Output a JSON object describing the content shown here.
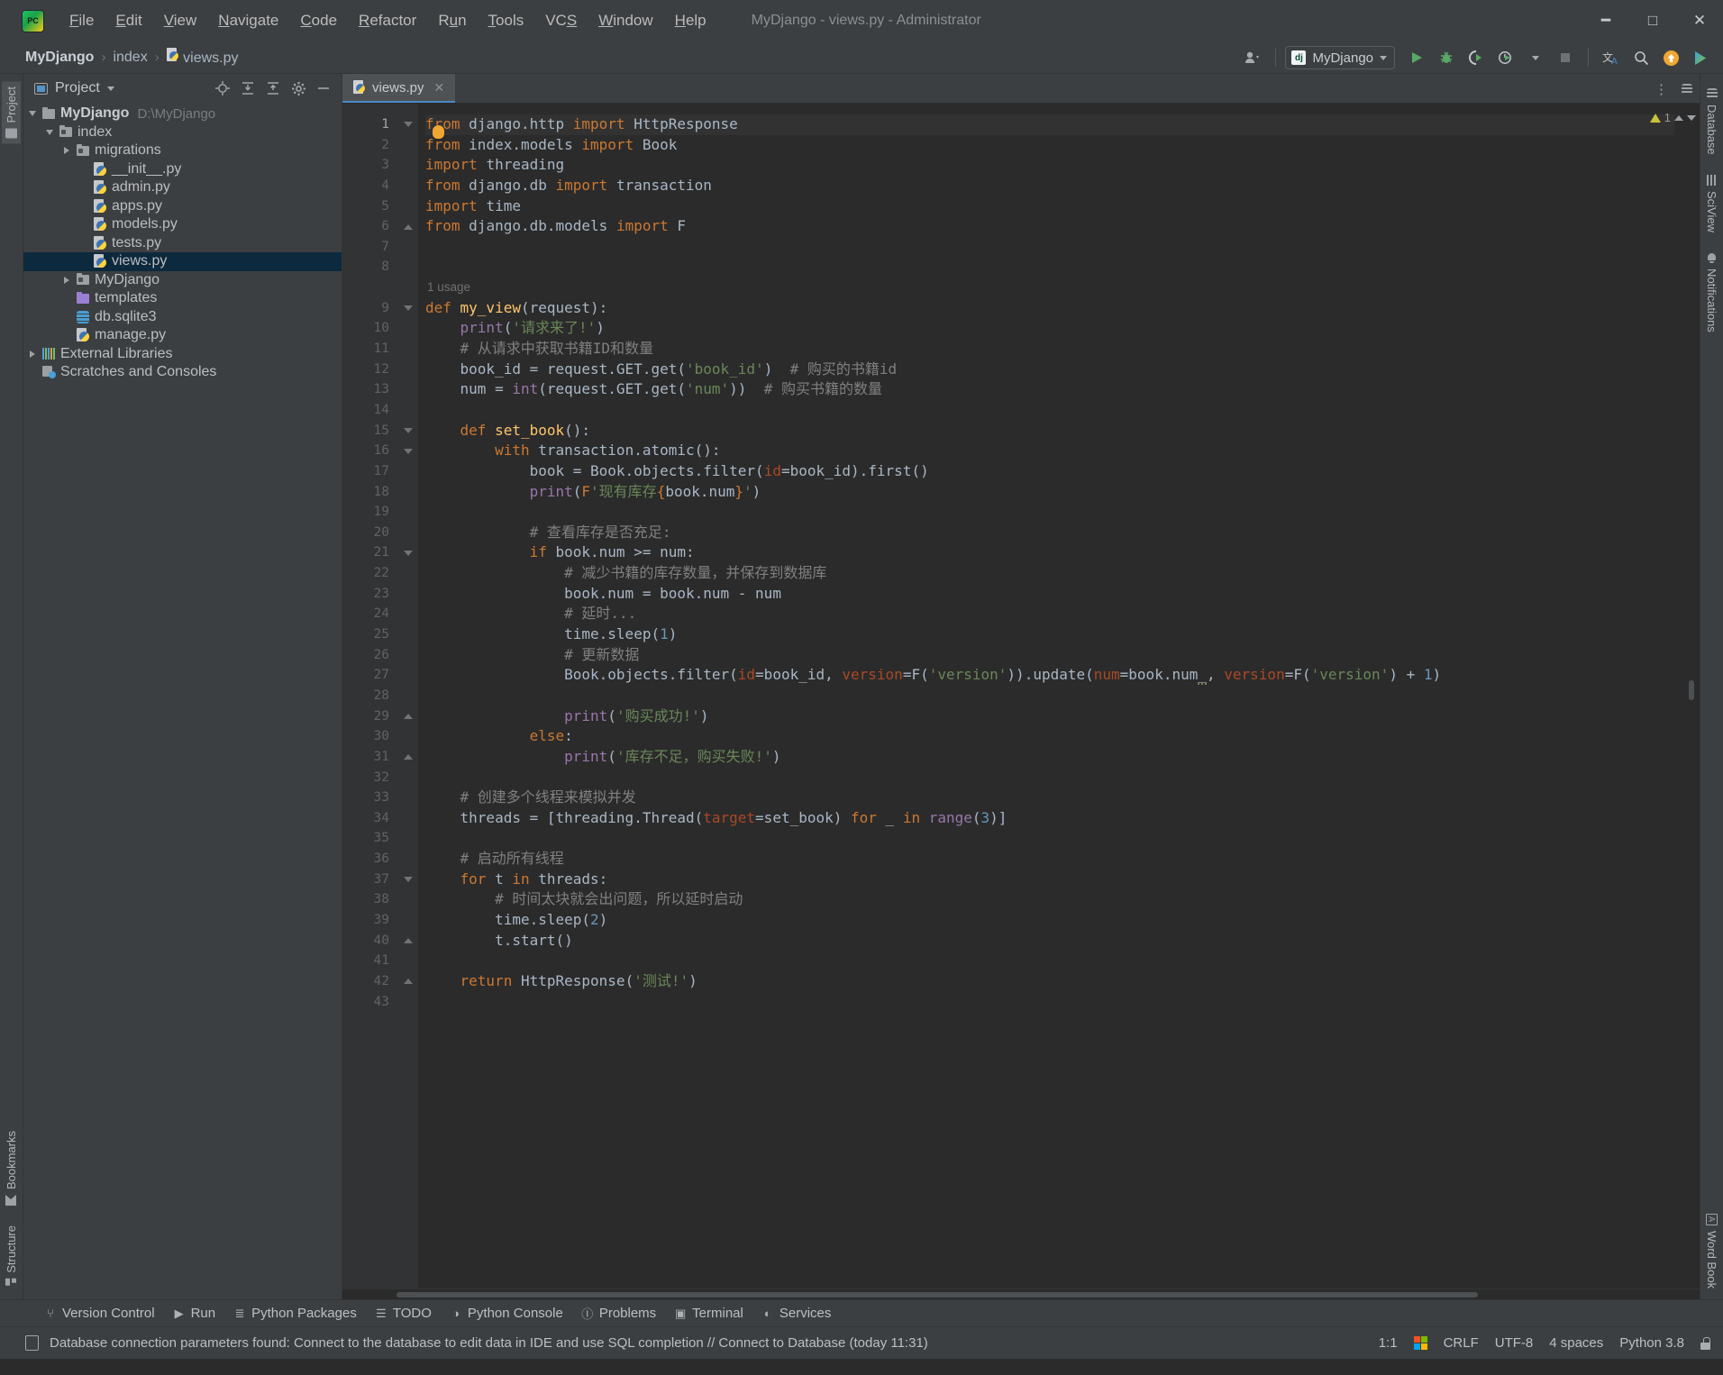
{
  "window": {
    "title": "MyDjango - views.py - Administrator",
    "minimize": "─",
    "maximize": "☐",
    "close": "✕"
  },
  "menu": [
    {
      "label": "File"
    },
    {
      "label": "Edit"
    },
    {
      "label": "View"
    },
    {
      "label": "Navigate"
    },
    {
      "label": "Code"
    },
    {
      "label": "Refactor"
    },
    {
      "label": "Run"
    },
    {
      "label": "Tools"
    },
    {
      "label": "VCS"
    },
    {
      "label": "Window"
    },
    {
      "label": "Help"
    }
  ],
  "breadcrumb": {
    "project": "MyDjango",
    "sep": "›",
    "folder": "index",
    "file": "views.py"
  },
  "toolbar": {
    "account_icon": "account-icon",
    "run_config_label": "MyDjango",
    "django_badge": "dj",
    "run_icon": "▶",
    "debug_icon": "debug-bug-icon",
    "coverage_icon": "coverage-icon",
    "profile_icon": "profile-clock-icon",
    "stop_icon": "■",
    "translate_icon": "文",
    "search_icon": "⌕",
    "update_icon": "↑",
    "ide_icon": "▶"
  },
  "left_rail": {
    "top": [
      {
        "label": "Project",
        "icon": "project-folder-icon",
        "active": true
      }
    ],
    "bottom": [
      {
        "label": "Bookmarks",
        "icon": "bookmark-icon"
      },
      {
        "label": "Structure",
        "icon": "structure-icon"
      }
    ]
  },
  "right_rail": {
    "top": [
      {
        "label": "Database",
        "icon": "database-icon"
      },
      {
        "label": "SciView",
        "icon": "sciview-grid-icon"
      },
      {
        "label": "Notifications",
        "icon": "bell-icon"
      }
    ],
    "bottom": [
      {
        "label": "Word Book",
        "icon": "word-book-icon"
      }
    ]
  },
  "project_panel": {
    "title": "Project",
    "dropdown_icon": "chevron-down-icon",
    "actions": [
      {
        "name": "locate-icon",
        "glyph": "⊕"
      },
      {
        "name": "expand-all-icon",
        "glyph": "⤓"
      },
      {
        "name": "collapse-all-icon",
        "glyph": "⤒"
      },
      {
        "name": "settings-gear-icon",
        "glyph": "⚙"
      },
      {
        "name": "hide-panel-icon",
        "glyph": "—"
      }
    ],
    "tree": [
      {
        "label": "MyDjango",
        "path": "D:\\MyDjango",
        "indent": 0,
        "twisty": "open",
        "icon": "folder-root-icon",
        "bold": true
      },
      {
        "label": "index",
        "path": "",
        "indent": 1,
        "twisty": "open",
        "icon": "folder-module-icon",
        "bold": false
      },
      {
        "label": "migrations",
        "path": "",
        "indent": 2,
        "twisty": "closed",
        "icon": "folder-module-icon",
        "bold": false
      },
      {
        "label": "__init__.py",
        "path": "",
        "indent": 3,
        "twisty": "none",
        "icon": "python-file-icon",
        "bold": false
      },
      {
        "label": "admin.py",
        "path": "",
        "indent": 3,
        "twisty": "none",
        "icon": "python-file-icon",
        "bold": false
      },
      {
        "label": "apps.py",
        "path": "",
        "indent": 3,
        "twisty": "none",
        "icon": "python-file-icon",
        "bold": false
      },
      {
        "label": "models.py",
        "path": "",
        "indent": 3,
        "twisty": "none",
        "icon": "python-file-icon",
        "bold": false
      },
      {
        "label": "tests.py",
        "path": "",
        "indent": 3,
        "twisty": "none",
        "icon": "python-file-icon",
        "bold": false
      },
      {
        "label": "views.py",
        "path": "",
        "indent": 3,
        "twisty": "none",
        "icon": "python-file-icon",
        "bold": false,
        "selected": true
      },
      {
        "label": "MyDjango",
        "path": "",
        "indent": 2,
        "twisty": "closed",
        "icon": "folder-module-icon",
        "bold": false
      },
      {
        "label": "templates",
        "path": "",
        "indent": 2,
        "twisty": "none",
        "icon": "folder-templates-icon",
        "bold": false
      },
      {
        "label": "db.sqlite3",
        "path": "",
        "indent": 2,
        "twisty": "none",
        "icon": "database-file-icon",
        "bold": false
      },
      {
        "label": "manage.py",
        "path": "",
        "indent": 2,
        "twisty": "none",
        "icon": "python-file-icon",
        "bold": false
      },
      {
        "label": "External Libraries",
        "path": "",
        "indent": 0,
        "twisty": "closed",
        "icon": "libraries-icon",
        "bold": false
      },
      {
        "label": "Scratches and Consoles",
        "path": "",
        "indent": 0,
        "twisty": "none",
        "icon": "scratches-icon",
        "bold": false
      }
    ]
  },
  "editor": {
    "tabs": [
      {
        "label": "views.py",
        "icon": "python-file-icon",
        "active": true,
        "close": "✕"
      }
    ],
    "kebab": "⋮",
    "warning_count": "1",
    "warning_icon": "warning-triangle-icon",
    "usage_hint": "1 usage",
    "usage_hint_line": 8,
    "total_lines": 43,
    "lines": [
      {
        "n": 1,
        "fold": "tri-down",
        "segs": [
          [
            "kw",
            "from "
          ],
          [
            "plain",
            "django.http "
          ],
          [
            "kw",
            "import "
          ],
          [
            "plain",
            "HttpResponse"
          ]
        ]
      },
      {
        "n": 2,
        "fold": "",
        "segs": [
          [
            "kw",
            "from "
          ],
          [
            "plain",
            "index.models "
          ],
          [
            "kw",
            "import "
          ],
          [
            "plain",
            "Book"
          ]
        ]
      },
      {
        "n": 3,
        "fold": "",
        "segs": [
          [
            "kw",
            "import "
          ],
          [
            "plain",
            "threading"
          ]
        ]
      },
      {
        "n": 4,
        "fold": "",
        "segs": [
          [
            "kw",
            "from "
          ],
          [
            "plain",
            "django.db "
          ],
          [
            "kw",
            "import "
          ],
          [
            "plain",
            "transaction"
          ]
        ]
      },
      {
        "n": 5,
        "fold": "",
        "segs": [
          [
            "kw",
            "import "
          ],
          [
            "plain",
            "time"
          ]
        ]
      },
      {
        "n": 6,
        "fold": "tri-up",
        "segs": [
          [
            "kw",
            "from "
          ],
          [
            "plain",
            "django.db.models "
          ],
          [
            "kw",
            "import "
          ],
          [
            "plain",
            "F"
          ]
        ]
      },
      {
        "n": 7,
        "fold": "",
        "segs": []
      },
      {
        "n": 8,
        "fold": "",
        "segs": []
      },
      {
        "n": 9,
        "fold": "tri-down",
        "segs": [
          [
            "kw",
            "def "
          ],
          [
            "deffn",
            "my_view"
          ],
          [
            "plain",
            "(request):"
          ]
        ]
      },
      {
        "n": 10,
        "fold": "",
        "segs": [
          [
            "plain",
            "    "
          ],
          [
            "purple",
            "print"
          ],
          [
            "plain",
            "("
          ],
          [
            "str",
            "'请求来了!'"
          ],
          [
            "plain",
            ")"
          ]
        ]
      },
      {
        "n": 11,
        "fold": "",
        "segs": [
          [
            "cmt",
            "    # 从请求中获取书籍ID和数量"
          ]
        ]
      },
      {
        "n": 12,
        "fold": "",
        "segs": [
          [
            "plain",
            "    book_id = request.GET.get("
          ],
          [
            "str",
            "'book_id'"
          ],
          [
            "plain",
            ")  "
          ],
          [
            "cmt",
            "# 购买的书籍id"
          ]
        ]
      },
      {
        "n": 13,
        "fold": "",
        "segs": [
          [
            "plain",
            "    num = "
          ],
          [
            "purple",
            "int"
          ],
          [
            "plain",
            "(request.GET.get("
          ],
          [
            "str",
            "'num'"
          ],
          [
            "plain",
            "))  "
          ],
          [
            "cmt",
            "# 购买书籍的数量"
          ]
        ]
      },
      {
        "n": 14,
        "fold": "",
        "segs": []
      },
      {
        "n": 15,
        "fold": "box",
        "segs": [
          [
            "plain",
            "    "
          ],
          [
            "kw",
            "def "
          ],
          [
            "deffn",
            "set_book"
          ],
          [
            "plain",
            "():"
          ]
        ]
      },
      {
        "n": 16,
        "fold": "box",
        "segs": [
          [
            "plain",
            "        "
          ],
          [
            "kw",
            "with "
          ],
          [
            "plain",
            "transaction.atomic():"
          ]
        ]
      },
      {
        "n": 17,
        "fold": "",
        "segs": [
          [
            "plain",
            "            book = Book.objects.filter("
          ],
          [
            "kwarg",
            "id"
          ],
          [
            "plain",
            "=book_id).first()"
          ]
        ]
      },
      {
        "n": 18,
        "fold": "",
        "segs": [
          [
            "plain",
            "            "
          ],
          [
            "purple",
            "print"
          ],
          [
            "plain",
            "("
          ],
          [
            "fn2",
            "F"
          ],
          [
            "str",
            "'现有库存"
          ],
          [
            "fstr-br",
            "{"
          ],
          [
            "plain",
            "book.num"
          ],
          [
            "fstr-br",
            "}"
          ],
          [
            "str",
            "'"
          ],
          [
            "plain",
            ")"
          ]
        ]
      },
      {
        "n": 19,
        "fold": "",
        "segs": []
      },
      {
        "n": 20,
        "fold": "",
        "segs": [
          [
            "cmt",
            "            # 查看库存是否充足:"
          ]
        ]
      },
      {
        "n": 21,
        "fold": "box",
        "segs": [
          [
            "plain",
            "            "
          ],
          [
            "kw",
            "if "
          ],
          [
            "plain",
            "book.num >= num:"
          ]
        ]
      },
      {
        "n": 22,
        "fold": "",
        "segs": [
          [
            "cmt",
            "                # 减少书籍的库存数量，并保存到数据库"
          ]
        ]
      },
      {
        "n": 23,
        "fold": "",
        "segs": [
          [
            "plain",
            "                book.num = book.num - num"
          ]
        ]
      },
      {
        "n": 24,
        "fold": "",
        "segs": [
          [
            "cmt",
            "                # 延时..."
          ]
        ]
      },
      {
        "n": 25,
        "fold": "",
        "segs": [
          [
            "plain",
            "                time.sleep("
          ],
          [
            "num",
            "1"
          ],
          [
            "plain",
            ")"
          ]
        ]
      },
      {
        "n": 26,
        "fold": "",
        "segs": [
          [
            "cmt",
            "                # 更新数据"
          ]
        ]
      },
      {
        "n": 27,
        "fold": "",
        "segs": [
          [
            "plain",
            "                Book.objects.filter("
          ],
          [
            "kwarg",
            "id"
          ],
          [
            "plain",
            "=book_id, "
          ],
          [
            "kwarg",
            "version"
          ],
          [
            "plain",
            "=F("
          ],
          [
            "str",
            "'version'"
          ],
          [
            "plain",
            ")).update("
          ],
          [
            "kwarg",
            "num"
          ],
          [
            "plain",
            "=book.num"
          ],
          [
            "squig",
            "_"
          ],
          [
            "plain",
            ", "
          ],
          [
            "kwarg",
            "version"
          ],
          [
            "plain",
            "=F("
          ],
          [
            "str",
            "'version'"
          ],
          [
            "plain",
            ") + "
          ],
          [
            "num",
            "1"
          ],
          [
            "plain",
            ")"
          ]
        ]
      },
      {
        "n": 28,
        "fold": "",
        "segs": []
      },
      {
        "n": 29,
        "fold": "box-up",
        "segs": [
          [
            "plain",
            "                "
          ],
          [
            "purple",
            "print"
          ],
          [
            "plain",
            "("
          ],
          [
            "str",
            "'购买成功!'"
          ],
          [
            "plain",
            ")"
          ]
        ]
      },
      {
        "n": 30,
        "fold": "",
        "segs": [
          [
            "plain",
            "            "
          ],
          [
            "kw",
            "else"
          ],
          [
            "plain",
            ":"
          ]
        ]
      },
      {
        "n": 31,
        "fold": "box-up",
        "segs": [
          [
            "plain",
            "                "
          ],
          [
            "purple",
            "print"
          ],
          [
            "plain",
            "("
          ],
          [
            "str",
            "'库存不足，购买失败!'"
          ],
          [
            "plain",
            ")"
          ]
        ]
      },
      {
        "n": 32,
        "fold": "",
        "segs": []
      },
      {
        "n": 33,
        "fold": "",
        "segs": [
          [
            "cmt",
            "    # 创建多个线程来模拟并发"
          ]
        ]
      },
      {
        "n": 34,
        "fold": "",
        "segs": [
          [
            "plain",
            "    threads = [threading.Thread("
          ],
          [
            "kwarg",
            "target"
          ],
          [
            "plain",
            "=set_book) "
          ],
          [
            "kw",
            "for "
          ],
          [
            "plain",
            "_ "
          ],
          [
            "kw",
            "in "
          ],
          [
            "purple",
            "range"
          ],
          [
            "plain",
            "("
          ],
          [
            "num",
            "3"
          ],
          [
            "plain",
            ")]"
          ]
        ]
      },
      {
        "n": 35,
        "fold": "",
        "segs": []
      },
      {
        "n": 36,
        "fold": "",
        "segs": [
          [
            "cmt",
            "    # 启动所有线程"
          ]
        ]
      },
      {
        "n": 37,
        "fold": "tri-down",
        "segs": [
          [
            "plain",
            "    "
          ],
          [
            "kw",
            "for "
          ],
          [
            "plain",
            "t "
          ],
          [
            "kw",
            "in "
          ],
          [
            "plain",
            "threads:"
          ]
        ]
      },
      {
        "n": 38,
        "fold": "",
        "segs": [
          [
            "cmt",
            "        # 时间太块就会出问题，所以延时启动"
          ]
        ]
      },
      {
        "n": 39,
        "fold": "",
        "segs": [
          [
            "plain",
            "        time.sleep("
          ],
          [
            "num",
            "2"
          ],
          [
            "plain",
            ")"
          ]
        ]
      },
      {
        "n": 40,
        "fold": "box-up",
        "segs": [
          [
            "plain",
            "        t.start()"
          ]
        ]
      },
      {
        "n": 41,
        "fold": "",
        "segs": []
      },
      {
        "n": 42,
        "fold": "box-up",
        "segs": [
          [
            "plain",
            "    "
          ],
          [
            "kw",
            "return "
          ],
          [
            "plain",
            "HttpResponse("
          ],
          [
            "str",
            "'测试!'"
          ],
          [
            "plain",
            ")"
          ]
        ]
      },
      {
        "n": 43,
        "fold": "",
        "segs": []
      }
    ]
  },
  "tool_windows": [
    {
      "label": "Version Control",
      "icon": "branch-icon",
      "glyph": "⑂"
    },
    {
      "label": "Run",
      "icon": "run-icon",
      "glyph": "▶"
    },
    {
      "label": "Python Packages",
      "icon": "packages-icon",
      "glyph": "≣"
    },
    {
      "label": "TODO",
      "icon": "todo-list-icon",
      "glyph": "☰"
    },
    {
      "label": "Python Console",
      "icon": "python-console-icon",
      "glyph": "◑"
    },
    {
      "label": "Problems",
      "icon": "problems-icon",
      "glyph": "Ⓘ"
    },
    {
      "label": "Terminal",
      "icon": "terminal-icon",
      "glyph": "▣"
    },
    {
      "label": "Services",
      "icon": "services-icon",
      "glyph": "◐"
    }
  ],
  "status_bar": {
    "message_icon": "notification-icon",
    "message": "Database connection parameters found: Connect to the database to edit data in IDE and use SQL completion // Connect to Database (today 11:31)",
    "caret_position": "1:1",
    "os_icon": "windows-logo-icon",
    "line_separator": "CRLF",
    "encoding": "UTF-8",
    "indent": "4 spaces",
    "interpreter": "Python 3.8",
    "lock_icon": "lock-icon"
  },
  "colors": {
    "background": "#3c3f41",
    "editor_background": "#2b2b2b",
    "gutter": "#313335",
    "selection": "#0d293e",
    "accent": "#4a88c7",
    "keyword": "#cc7832",
    "string": "#6a8759",
    "number": "#6897bb",
    "comment": "#808080",
    "function": "#ffc66d",
    "builtin": "#9876aa",
    "kwarg": "#aa4926",
    "text": "#a9b7c6"
  }
}
